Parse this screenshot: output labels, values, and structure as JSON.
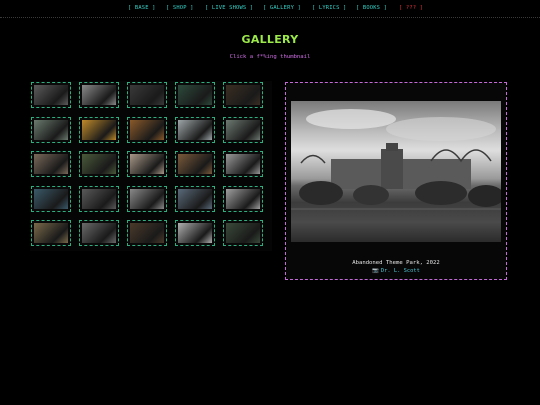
{
  "nav": {
    "items": [
      {
        "label": "[ BASE ]",
        "color": "#35d0c6"
      },
      {
        "label": "[ SHOP ]",
        "color": "#35d0c6"
      },
      {
        "label": "[ LIVE SHOWS ]",
        "color": "#35d0c6"
      },
      {
        "label": "[ GALLERY ]",
        "color": "#35d0c6"
      },
      {
        "label": "[ LYRICS ]",
        "color": "#35d0c6"
      },
      {
        "label": "[ BOOKS ]",
        "color": "#35d0c6"
      },
      {
        "label": "[ ??? ]",
        "color": "#e0303a"
      }
    ]
  },
  "page": {
    "title": "GALLERY",
    "subtitle": "Click a f*%ing thumbnail"
  },
  "thumbnails": [
    {
      "tone": "#5c5c5c"
    },
    {
      "tone": "#8a8a8a"
    },
    {
      "tone": "#3a3a3a"
    },
    {
      "tone": "#2c4a3c"
    },
    {
      "tone": "#3a2e22"
    },
    {
      "tone": "#6a7a6e"
    },
    {
      "tone": "#c08a2a"
    },
    {
      "tone": "#8a5a2a"
    },
    {
      "tone": "#9ea6a8"
    },
    {
      "tone": "#6e7a72"
    },
    {
      "tone": "#7a6a5a"
    },
    {
      "tone": "#4a5a3a"
    },
    {
      "tone": "#a89888"
    },
    {
      "tone": "#7a5a3a"
    },
    {
      "tone": "#9a9a9a"
    },
    {
      "tone": "#3a5a6a"
    },
    {
      "tone": "#5a5a5a"
    },
    {
      "tone": "#8a8a8a"
    },
    {
      "tone": "#5a6a7a"
    },
    {
      "tone": "#a0a0a0"
    },
    {
      "tone": "#7a6a4a"
    },
    {
      "tone": "#6a6a6a"
    },
    {
      "tone": "#4a3a2a"
    },
    {
      "tone": "#b0b0b0"
    },
    {
      "tone": "#3a4a3a"
    }
  ],
  "preview": {
    "caption": "Abandoned Theme Park, 2022",
    "credit_icon": "📷",
    "credit": "Dr. L. Scott"
  },
  "colors": {
    "title": "#9be94a",
    "subtitle": "#d06ee6",
    "thumb_border": "#2fae80",
    "preview_border": "#c56ad8"
  }
}
